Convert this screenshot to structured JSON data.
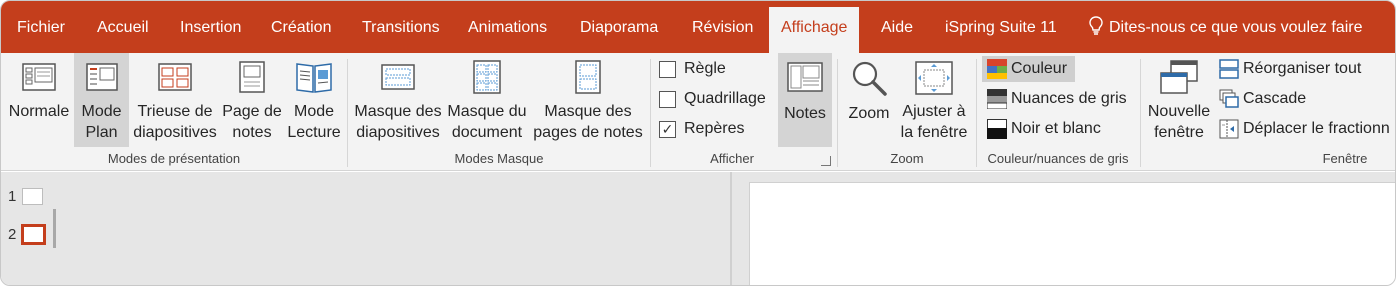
{
  "tabs": [
    {
      "label": "Fichier"
    },
    {
      "label": "Accueil"
    },
    {
      "label": "Insertion"
    },
    {
      "label": "Création"
    },
    {
      "label": "Transitions"
    },
    {
      "label": "Animations"
    },
    {
      "label": "Diaporama"
    },
    {
      "label": "Révision"
    },
    {
      "label": "Affichage",
      "active": true
    },
    {
      "label": "Aide"
    },
    {
      "label": "iSpring Suite 11"
    },
    {
      "label": "Dites-nous ce que vous voulez faire"
    }
  ],
  "groups": {
    "presentation_views": {
      "label": "Modes de présentation",
      "buttons": [
        {
          "label": "Normale",
          "icon": "normal-view-icon"
        },
        {
          "label": "Mode\nPlan",
          "icon": "outline-view-icon",
          "pressed": true
        },
        {
          "label": "Trieuse de\ndiapositives",
          "icon": "slide-sorter-icon"
        },
        {
          "label": "Page de\nnotes",
          "icon": "notes-page-icon"
        },
        {
          "label": "Mode\nLecture",
          "icon": "reading-view-icon"
        }
      ]
    },
    "master_views": {
      "label": "Modes Masque",
      "buttons": [
        {
          "label": "Masque des\ndiapositives",
          "icon": "slide-master-icon"
        },
        {
          "label": "Masque du\ndocument",
          "icon": "handout-master-icon"
        },
        {
          "label": "Masque des\npages de notes",
          "icon": "notes-master-icon"
        }
      ]
    },
    "show": {
      "label": "Afficher",
      "checkboxes": [
        {
          "label": "Règle",
          "checked": false
        },
        {
          "label": "Quadrillage",
          "checked": false
        },
        {
          "label": "Repères",
          "checked": true
        }
      ],
      "notes_button": {
        "label": "Notes",
        "pressed": true
      },
      "checkmark": "✓"
    },
    "zoom": {
      "label": "Zoom",
      "buttons": [
        {
          "label": "Zoom",
          "icon": "magnifier-icon"
        },
        {
          "label": "Ajuster à\nla fenêtre",
          "icon": "fit-to-window-icon"
        }
      ]
    },
    "color": {
      "label": "Couleur/nuances de gris",
      "options": [
        {
          "label": "Couleur",
          "selected": true
        },
        {
          "label": "Nuances de gris",
          "selected": false
        },
        {
          "label": "Noir et blanc",
          "selected": false
        }
      ]
    },
    "window": {
      "label": "Fenêtre",
      "new_window": {
        "label": "Nouvelle\nfenêtre"
      },
      "items": [
        {
          "label": "Réorganiser tout"
        },
        {
          "label": "Cascade"
        },
        {
          "label": "Déplacer le fractionn"
        }
      ]
    }
  },
  "outline": {
    "slides": [
      {
        "number": "1"
      },
      {
        "number": "2",
        "selected": true
      }
    ]
  },
  "colors": {
    "accent": "#c43e1c",
    "ribbon": "#f3f3f3",
    "pane": "#e6e6e6"
  }
}
